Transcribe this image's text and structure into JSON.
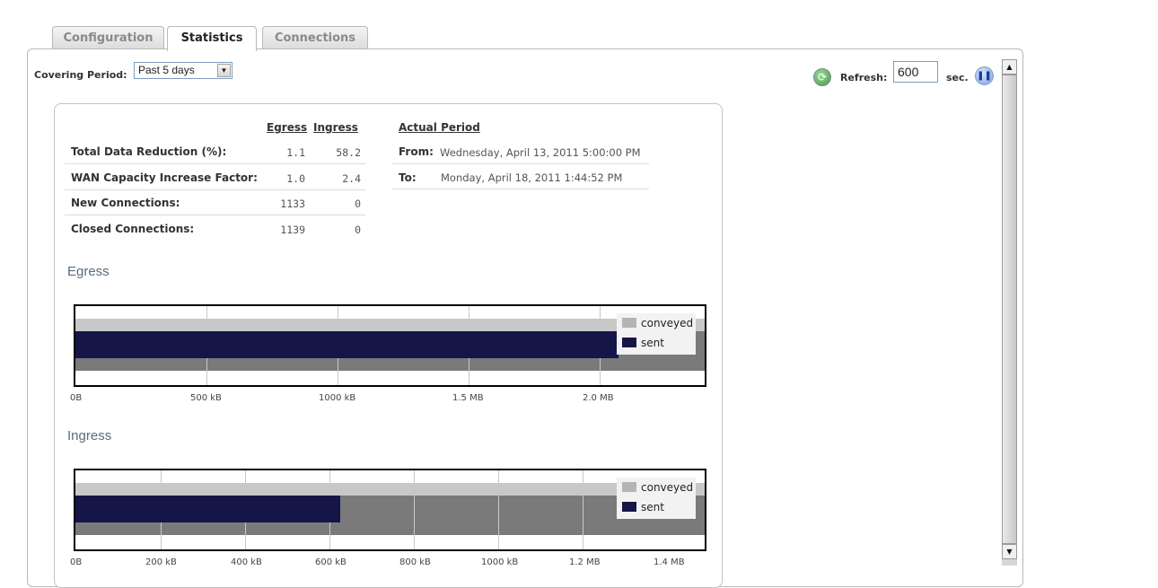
{
  "tabs": [
    {
      "label": "Configuration",
      "active": false
    },
    {
      "label": "Statistics",
      "active": true
    },
    {
      "label": "Connections",
      "active": false
    }
  ],
  "covering_period": {
    "label": "Covering Period:",
    "value": "Past 5 days"
  },
  "refresh": {
    "label": "Refresh:",
    "value": "600",
    "unit": "sec."
  },
  "stats": {
    "headers": {
      "egress": "Egress",
      "ingress": "Ingress"
    },
    "rows": [
      {
        "label": "Total Data Reduction (%):",
        "egress": "1.1",
        "ingress": "58.2"
      },
      {
        "label": "WAN Capacity Increase Factor:",
        "egress": "1.0",
        "ingress": "2.4"
      },
      {
        "label": "New Connections:",
        "egress": "1133",
        "ingress": "0"
      },
      {
        "label": "Closed Connections:",
        "egress": "1139",
        "ingress": "0"
      }
    ]
  },
  "actual_period": {
    "heading": "Actual Period",
    "from_label": "From:",
    "from_value": "Wednesday, April 13, 2011 5:00:00 PM",
    "to_label": "To:",
    "to_value": "Monday, April 18, 2011 1:44:52 PM"
  },
  "charts": {
    "egress": {
      "title": "Egress",
      "legend": [
        "conveyed",
        "sent"
      ],
      "ticks": [
        "0B",
        "500 kB",
        "1000 kB",
        "1.5 MB",
        "2.0 MB"
      ]
    },
    "ingress": {
      "title": "Ingress",
      "legend": [
        "conveyed",
        "sent"
      ],
      "ticks": [
        "0B",
        "200 kB",
        "400 kB",
        "600 kB",
        "800 kB",
        "1000 kB",
        "1.2 MB",
        "1.4 MB"
      ]
    }
  },
  "chart_data": [
    {
      "type": "bar",
      "title": "Egress",
      "categories": [
        "Egress"
      ],
      "series": [
        {
          "name": "conveyed",
          "values": [
            2.4
          ]
        },
        {
          "name": "sent",
          "values": [
            2.4
          ]
        }
      ],
      "unit": "MB",
      "xlim": [
        0,
        2.4
      ]
    },
    {
      "type": "bar",
      "title": "Ingress",
      "categories": [
        "Ingress"
      ],
      "series": [
        {
          "name": "conveyed",
          "values": [
            1.5
          ]
        },
        {
          "name": "sent",
          "values": [
            0.62
          ]
        }
      ],
      "unit": "MB",
      "xlim": [
        0,
        1.5
      ]
    }
  ],
  "colors": {
    "sent": "#151548",
    "conveyed": "#7a7a7a",
    "conveyed_light": "#c8c8c8"
  },
  "icons": {
    "refresh": "refresh-icon",
    "pause": "pause-icon"
  }
}
